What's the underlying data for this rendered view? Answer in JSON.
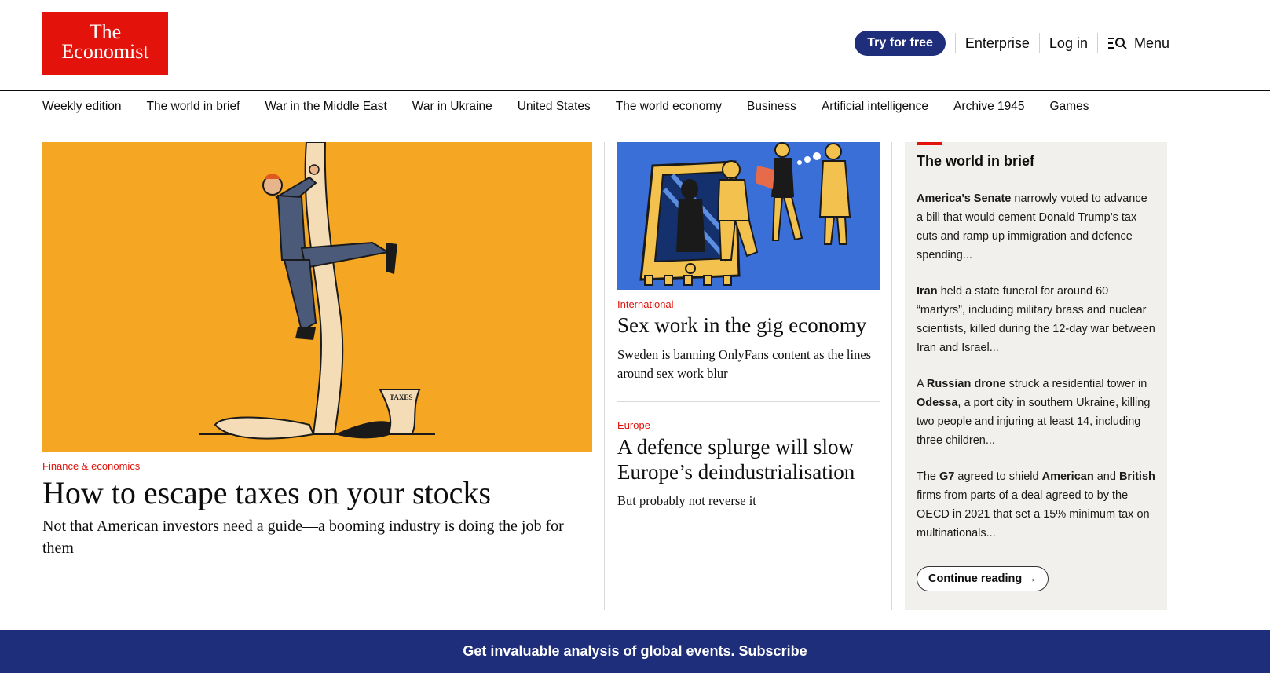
{
  "brand": {
    "line1": "The",
    "line2": "Economist",
    "color": "#e3120b"
  },
  "header": {
    "try_label": "Try for free",
    "enterprise_label": "Enterprise",
    "login_label": "Log in",
    "menu_label": "Menu"
  },
  "nav": {
    "items": [
      "Weekly edition",
      "The world in brief",
      "War in the Middle East",
      "War in Ukraine",
      "United States",
      "The world economy",
      "Business",
      "Artificial intelligence",
      "Archive 1945",
      "Games"
    ]
  },
  "lead": {
    "kicker": "Finance & economics",
    "title": "How to escape taxes on your stocks",
    "description": "Not that American investors need a guide—a booming industry is doing the job for them",
    "image_bg": "#f5a623",
    "receipt_text": "TAXES"
  },
  "middle": {
    "story1": {
      "kicker": "International",
      "title": "Sex work in the gig economy",
      "description": "Sweden is banning OnlyFans content as the lines around sex work blur",
      "image_bg": "#3a6fd8"
    },
    "story2": {
      "kicker": "Europe",
      "title": "A defence splurge will slow Europe’s deindustrialisation",
      "description": "But probably not reverse it"
    }
  },
  "brief": {
    "title": "The world in brief",
    "items": [
      {
        "bold": "America’s Senate",
        "text": " narrowly voted to advance a bill that would cement Donald Trump’s tax cuts and ramp up immigration and defence spending..."
      },
      {
        "bold": "Iran",
        "text": " held a state funeral for around 60 “martyrs”, including military brass and nuclear scientists, killed during the 12-day war between Iran and Israel..."
      },
      {
        "pre": "A ",
        "bold": "Russian drone",
        "mid": " struck a residential tower in ",
        "bold2": "Odessa",
        "text": ", a port city in southern Ukraine, killing two people and injuring at least 14, including three children..."
      },
      {
        "pre": "The ",
        "bold": "G7",
        "mid": " agreed to shield ",
        "bold2": "American",
        "mid2": " and ",
        "bold3": "British",
        "text": " firms from parts of a deal agreed to by the OECD in 2021 that set a 15% minimum tax on multinationals..."
      }
    ],
    "continue_label": "Continue reading →"
  },
  "banner": {
    "text": "Get invaluable analysis of global events.",
    "subscribe_label": "Subscribe",
    "bg": "#1f2e7a"
  }
}
